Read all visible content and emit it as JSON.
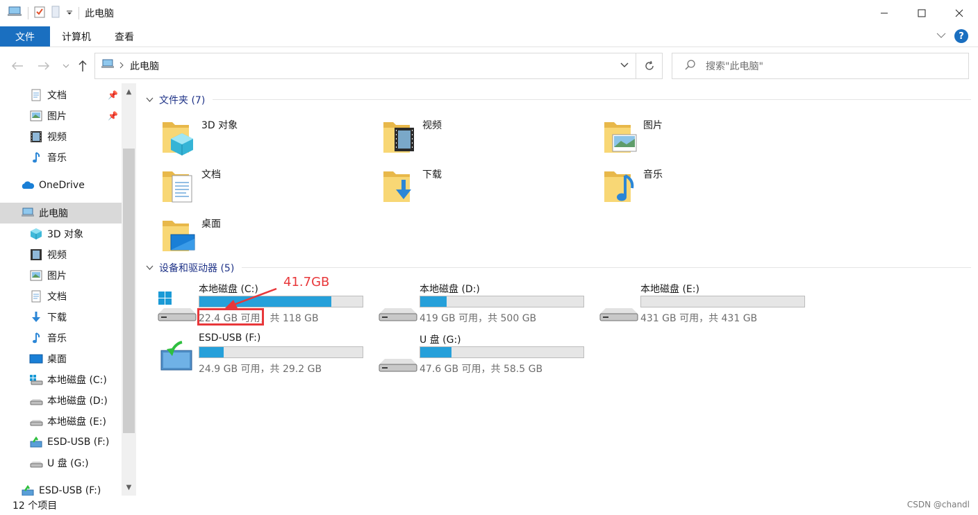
{
  "window": {
    "title": "此电脑"
  },
  "ribbon": {
    "tabs": [
      "文件",
      "计算机",
      "查看"
    ]
  },
  "address": {
    "path": "此电脑"
  },
  "search": {
    "placeholder": "搜索\"此电脑\""
  },
  "sidebar": {
    "items": [
      {
        "label": "文档",
        "icon": "document-icon",
        "pinned": true
      },
      {
        "label": "图片",
        "icon": "picture-icon",
        "pinned": true
      },
      {
        "label": "视频",
        "icon": "video-icon"
      },
      {
        "label": "音乐",
        "icon": "music-icon"
      },
      {
        "label": "OneDrive",
        "icon": "onedrive-icon"
      },
      {
        "label": "此电脑",
        "icon": "this-pc-icon",
        "selected": true
      },
      {
        "label": "3D 对象",
        "icon": "3d-objects-icon"
      },
      {
        "label": "视频",
        "icon": "video-icon"
      },
      {
        "label": "图片",
        "icon": "picture-icon"
      },
      {
        "label": "文档",
        "icon": "document-icon"
      },
      {
        "label": "下载",
        "icon": "download-icon"
      },
      {
        "label": "音乐",
        "icon": "music-icon"
      },
      {
        "label": "桌面",
        "icon": "desktop-icon"
      },
      {
        "label": "本地磁盘 (C:)",
        "icon": "windows-drive-icon"
      },
      {
        "label": "本地磁盘 (D:)",
        "icon": "drive-icon"
      },
      {
        "label": "本地磁盘 (E:)",
        "icon": "drive-icon"
      },
      {
        "label": "ESD-USB (F:)",
        "icon": "usb-drive-icon"
      },
      {
        "label": "U 盘 (G:)",
        "icon": "drive-icon"
      },
      {
        "label": "ESD-USB (F:)",
        "icon": "usb-drive-icon"
      }
    ]
  },
  "folders_group": {
    "title": "文件夹 (7)",
    "items": [
      {
        "label": "3D 对象",
        "icon": "3d-objects-folder-icon"
      },
      {
        "label": "视频",
        "icon": "video-folder-icon"
      },
      {
        "label": "图片",
        "icon": "picture-folder-icon"
      },
      {
        "label": "文档",
        "icon": "document-folder-icon"
      },
      {
        "label": "下载",
        "icon": "download-folder-icon"
      },
      {
        "label": "音乐",
        "icon": "music-folder-icon"
      },
      {
        "label": "桌面",
        "icon": "desktop-folder-icon"
      }
    ]
  },
  "drives_group": {
    "title": "设备和驱动器 (5)",
    "items": [
      {
        "label": "本地磁盘 (C:)",
        "free": "22.4 GB 可用，共 118 GB",
        "used_fraction": 0.81,
        "icon": "windows-drive-icon"
      },
      {
        "label": "本地磁盘 (D:)",
        "free": "419 GB 可用，共 500 GB",
        "used_fraction": 0.16,
        "icon": "drive-icon"
      },
      {
        "label": "本地磁盘 (E:)",
        "free": "431 GB 可用，共 431 GB",
        "used_fraction": 0.0,
        "icon": "drive-icon"
      },
      {
        "label": "ESD-USB (F:)",
        "free": "24.9 GB 可用，共 29.2 GB",
        "used_fraction": 0.15,
        "icon": "usb-drive-icon"
      },
      {
        "label": "U 盘 (G:)",
        "free": "47.6 GB 可用，共 58.5 GB",
        "used_fraction": 0.19,
        "icon": "drive-icon"
      }
    ]
  },
  "annotation": {
    "text": "41.7GB",
    "color": "#e8373a"
  },
  "status": {
    "item_count": "12 个项目"
  },
  "watermark": {
    "text": "CSDN @chandl"
  },
  "colors": {
    "accent": "#1a6fc0",
    "bar_fill": "#26a0da",
    "group_header": "#1e3287"
  }
}
